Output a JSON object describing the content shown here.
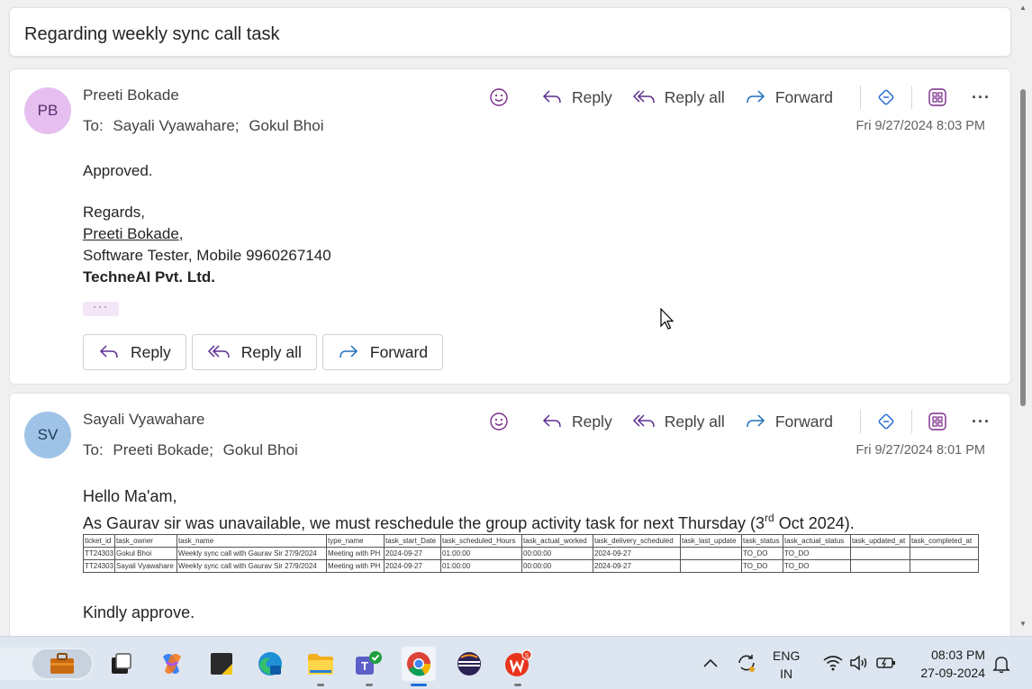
{
  "subject": "Regarding weekly sync call task",
  "actions": {
    "reply": "Reply",
    "reply_all": "Reply all",
    "forward": "Forward"
  },
  "message1": {
    "initials": "PB",
    "sender": "Preeti Bokade",
    "to_label": "To:",
    "recipients": [
      "Sayali Vyawahare;",
      "Gokul Bhoi"
    ],
    "date": "Fri 9/27/2024 8:03 PM",
    "body": {
      "approved": "Approved.",
      "regards": "Regards,",
      "sig_name": "Preeti Bokade",
      "sig_comma": ",",
      "sig_title": "Software Tester, Mobile 9960267140",
      "company": "TechneAI Pvt. Ltd."
    },
    "ellipsis": "···"
  },
  "message2": {
    "initials": "SV",
    "sender": "Sayali Vyawahare",
    "to_label": "To:",
    "recipients": [
      "Preeti Bokade;",
      "Gokul Bhoi"
    ],
    "date": "Fri 9/27/2024 8:01 PM",
    "greeting": "Hello Ma'am,",
    "line_pre": "As Gaurav sir was unavailable, we must reschedule the group activity task for next Thursday (3",
    "line_sup": "rd",
    "line_post": " Oct 2024).",
    "table": {
      "headers": [
        "ticket_id",
        "task_owner",
        "task_name",
        "type_name",
        "task_start_Date",
        "task_scheduled_Hours",
        "task_actual_worked",
        "task_delivery_scheduled",
        "task_last_update",
        "task_status",
        "task_actual_status",
        "task_updated_at",
        "task_completed_at"
      ],
      "rows": [
        [
          "TT24303",
          "Gokul Bhoi",
          "Weekly sync call with Gaurav Sir 27/9/2024",
          "Meeting with PH",
          "2024-09-27",
          "01:00:00",
          "00:00:00",
          "2024-09-27",
          "",
          "TO_DO",
          "TO_DO",
          "",
          ""
        ],
        [
          "TT24303",
          "Sayali Vyawahare",
          "Weekly sync call with Gaurav Sir 27/9/2024",
          "Meeting with PH",
          "2024-09-27",
          "01:00:00",
          "00:00:00",
          "2024-09-27",
          "",
          "TO_DO",
          "TO_DO",
          "",
          ""
        ]
      ]
    },
    "closing": "Kindly approve."
  },
  "taskbar": {
    "apps": [
      "work-briefcase",
      "task-view",
      "copilot",
      "sticky-notes",
      "edge",
      "file-explorer",
      "teams",
      "chrome",
      "eclipse",
      "wps-office"
    ],
    "lang_top": "ENG",
    "lang_bottom": "IN",
    "time": "08:03 PM",
    "date": "27-09-2024"
  },
  "colors": {
    "accent": "#7a2a8a",
    "reply_icon": "#5c2d91",
    "forward_icon": "#1f6fb8"
  }
}
